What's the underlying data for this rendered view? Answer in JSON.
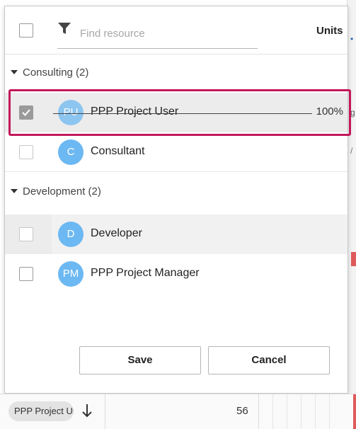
{
  "search": {
    "placeholder": "Find resource",
    "value": ""
  },
  "header": {
    "units_label": "Units"
  },
  "groups": [
    {
      "label": "Consulting (2)"
    },
    {
      "label": "Development (2)"
    }
  ],
  "resources": [
    {
      "initials": "PU",
      "name": "PPP Project User",
      "units": "100%",
      "checked": true
    },
    {
      "initials": "C",
      "name": "Consultant",
      "units": "",
      "checked": false
    },
    {
      "initials": "D",
      "name": "Developer",
      "units": "",
      "checked": false
    },
    {
      "initials": "PM",
      "name": "PPP Project Manager",
      "units": "",
      "checked": false
    }
  ],
  "buttons": {
    "save": "Save",
    "cancel": "Cancel"
  },
  "background": {
    "chip_label": "PPP Project User",
    "value": "56",
    "edge_letters": [
      "g",
      "/"
    ]
  },
  "colors": {
    "avatar": "#6cb8f2",
    "highlight_outline": "#c2185b"
  }
}
